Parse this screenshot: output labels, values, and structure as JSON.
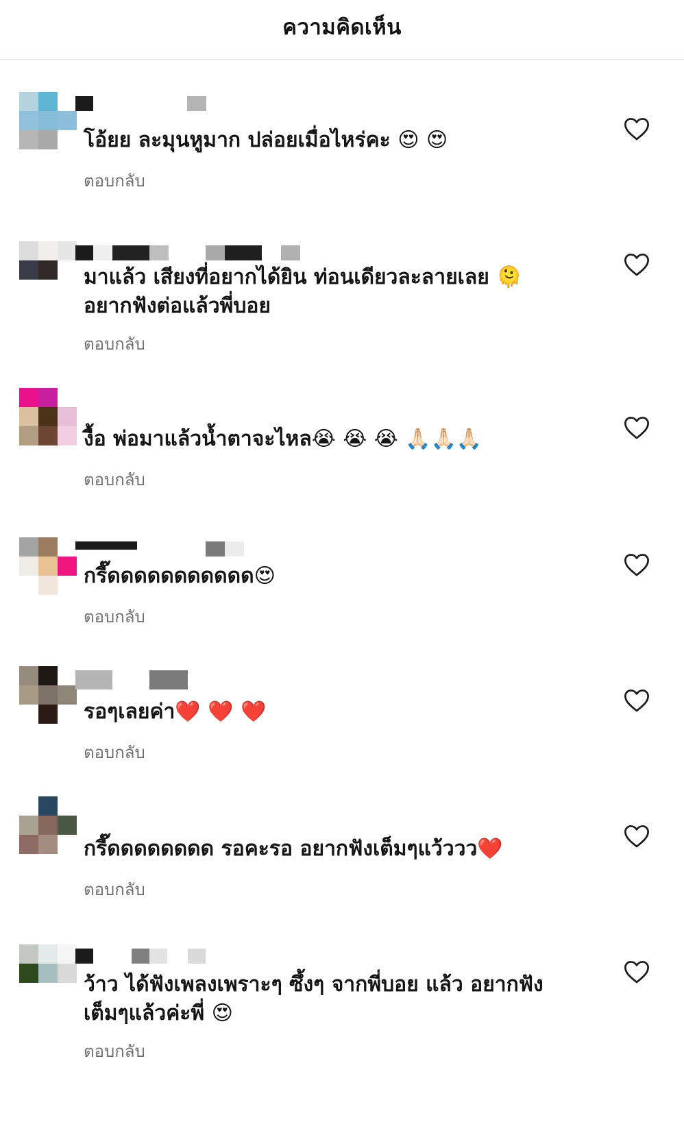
{
  "header": {
    "title": "ความคิดเห็น"
  },
  "colors": {
    "accent_text": "#111111",
    "reply_gray": "#6f6f6f",
    "divider": "#ececec"
  },
  "comments": [
    {
      "text": "โอ้ยย ละมุนหูมาก  ปล่อยเมื่อไหร่คะ 😍 😍",
      "reply_label": "ตอบกลับ",
      "like_icon": "heart-outline-icon"
    },
    {
      "text": "มาแล้ว เสียงที่อยากได้ยิน ท่อนเดียวละลายเลย 🫠 อยากฟังต่อแล้วพี่บอย",
      "reply_label": "ตอบกลับ",
      "like_icon": "heart-outline-icon"
    },
    {
      "text": "งื้อ พ่อมาแล้วน้ำตาจะไหล😭 😭 😭 🙏🏻🙏🏻🙏🏻",
      "reply_label": "ตอบกลับ",
      "like_icon": "heart-outline-icon"
    },
    {
      "text": "กรี๊ดดดดดดดดดดด😍",
      "reply_label": "ตอบกลับ",
      "like_icon": "heart-outline-icon"
    },
    {
      "text": "รอๆเลยค่า❤️ ❤️ ❤️",
      "reply_label": "ตอบกลับ",
      "like_icon": "heart-outline-icon"
    },
    {
      "text": "กรี๊ดดดดดดดด รอคะรอ อยากฟังเต็มๆแว้ววว❤️",
      "reply_label": "ตอบกลับ",
      "like_icon": "heart-outline-icon"
    },
    {
      "text": "ว้าว ได้ฟังเพลงเพราะๆ ซึ้งๆ จากพี่บอย แล้ว อยากฟัง เต็มๆแล้วค่ะพี่ 😍",
      "reply_label": "ตอบกลับ",
      "like_icon": "heart-outline-icon"
    }
  ]
}
